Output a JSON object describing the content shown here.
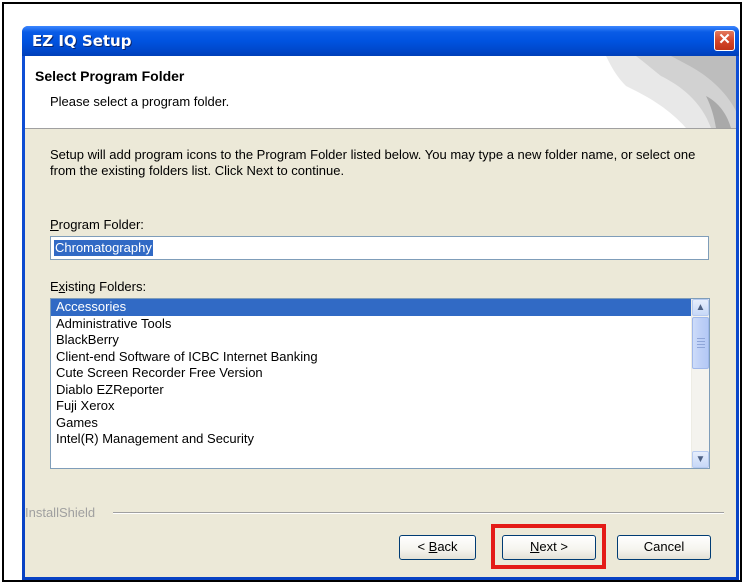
{
  "window": {
    "title": "EZ IQ Setup",
    "close_glyph": "✕"
  },
  "header": {
    "title": "Select Program Folder",
    "subtitle": "Please select a program folder."
  },
  "intro_text": "Setup will add program icons to the Program Folder listed below.  You may type a new folder name, or select one from the existing folders list.  Click Next to continue.",
  "program_folder": {
    "label_mnemonic": "P",
    "label_rest": "rogram Folder:",
    "value": "Chromatography"
  },
  "existing_folders": {
    "label_pre": "E",
    "label_mnemonic": "x",
    "label_rest": "isting Folders:",
    "items": [
      "Accessories",
      "Administrative Tools",
      "BlackBerry",
      "Client-end Software of ICBC Internet Banking",
      "Cute Screen Recorder Free Version",
      "Diablo EZReporter",
      "Fuji Xerox",
      "Games",
      "Intel(R) Management and Security"
    ],
    "selected_index": 0
  },
  "footer": {
    "brand": "InstallShield"
  },
  "buttons": {
    "back_prefix": "< ",
    "back_mnemonic": "B",
    "back_rest": "ack",
    "next_mnemonic": "N",
    "next_rest": "ext >",
    "cancel": "Cancel"
  },
  "colors": {
    "highlight": "#e41b17",
    "selection": "#316ac5",
    "titlebar": "#0053e0"
  }
}
